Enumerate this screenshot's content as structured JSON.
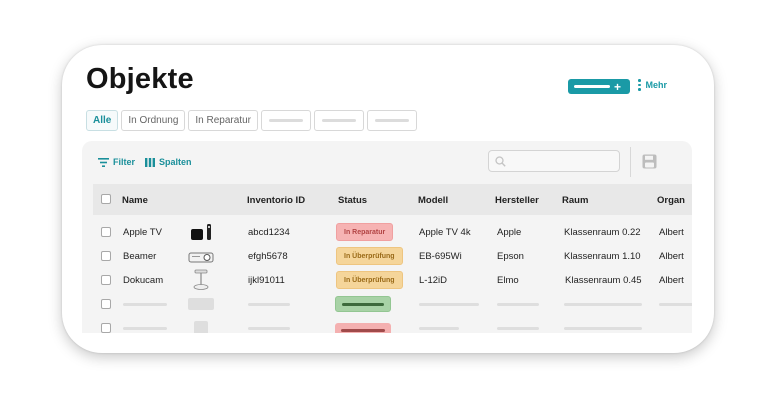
{
  "page": {
    "title": "Objekte"
  },
  "header": {
    "more_label": "Mehr"
  },
  "tabs": [
    {
      "label": "Alle",
      "active": true
    },
    {
      "label": "In Ordnung",
      "active": false
    },
    {
      "label": "In Reparatur",
      "active": false
    }
  ],
  "toolbar": {
    "filter_label": "Filter",
    "columns_label": "Spalten",
    "search_placeholder": ""
  },
  "table": {
    "columns": [
      "Name",
      "Inventorio ID",
      "Status",
      "Modell",
      "Hersteller",
      "Raum",
      "Organ"
    ],
    "rows": [
      {
        "name": "Apple TV",
        "id": "abcd1234",
        "status": "In Reparatur",
        "status_color": "red",
        "modell": "Apple TV 4k",
        "hersteller": "Apple",
        "raum": "Klassenraum 0.22",
        "organ": "Albert"
      },
      {
        "name": "Beamer",
        "id": "efgh5678",
        "status": "In Überprüfung",
        "status_color": "amber",
        "modell": "EB-695Wi",
        "hersteller": "Epson",
        "raum": "Klassenraum 1.10",
        "organ": "Albert"
      },
      {
        "name": "Dokucam",
        "id": "ijkl91011",
        "status": "In Überprüfung",
        "status_color": "amber",
        "modell": "L-12iD",
        "hersteller": "Elmo",
        "raum": "Klassenraum 0.45",
        "organ": "Albert"
      }
    ]
  },
  "colors": {
    "accent": "#1a9aa6",
    "status_red": "#f6b3b3",
    "status_amber": "#f5d59a",
    "status_green": "#a8d2a6"
  }
}
